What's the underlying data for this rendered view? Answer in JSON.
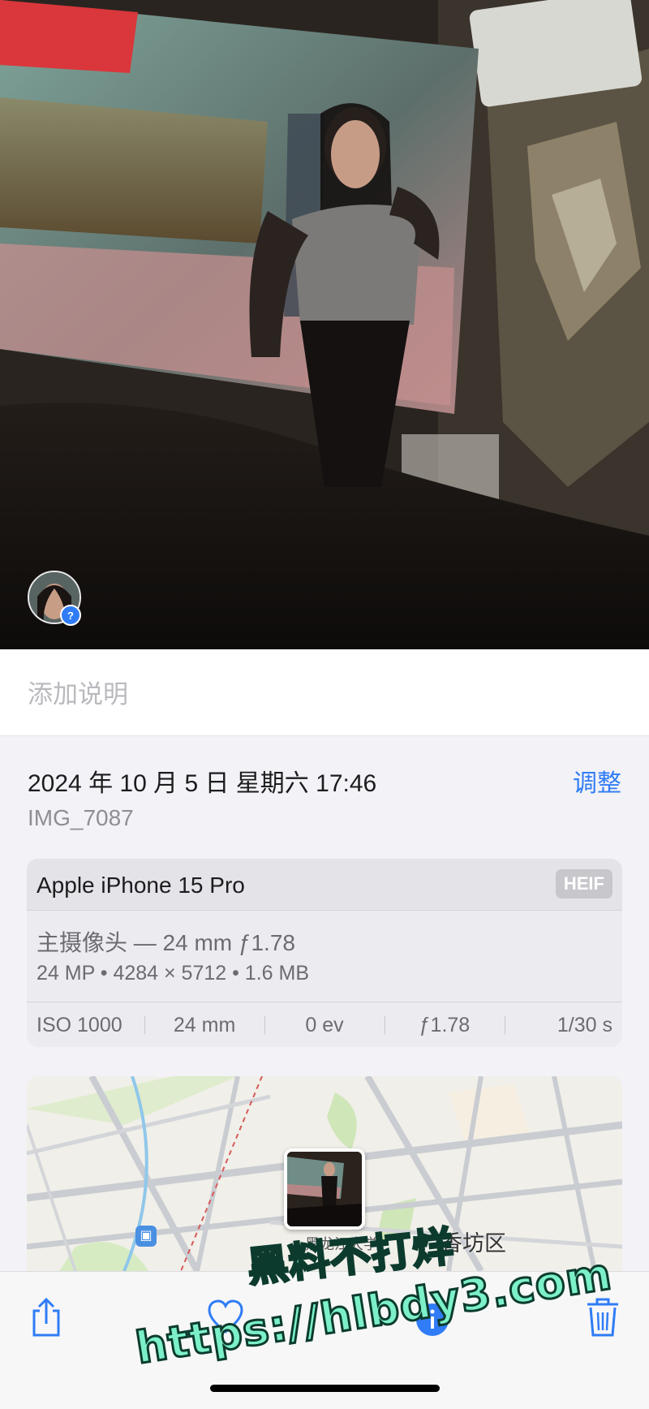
{
  "caption": {
    "placeholder": "添加说明"
  },
  "info": {
    "date": "2024 年 10 月 5 日 星期六 17:46",
    "adjust_label": "调整",
    "filename": "IMG_7087"
  },
  "camera": {
    "device": "Apple iPhone 15 Pro",
    "format": "HEIF",
    "lens": "主摄像头 — 24 mm ƒ1.78",
    "specs": "24 MP • 4284 × 5712 • 1.6 MB",
    "exif": [
      "ISO 1000",
      "24 mm",
      "0 ev",
      "ƒ1.78",
      "1/30 s"
    ]
  },
  "map": {
    "labels": {
      "district": "香坊区",
      "university": "黑龙江大学"
    }
  },
  "face_badge": "?",
  "toolbar": {
    "share_icon": "share-icon",
    "favorite_icon": "heart-icon",
    "info_icon": "info-icon",
    "delete_icon": "trash-icon"
  },
  "watermark": {
    "line1": "黑料不打烊",
    "line2": "https://hlbdy3.com"
  }
}
